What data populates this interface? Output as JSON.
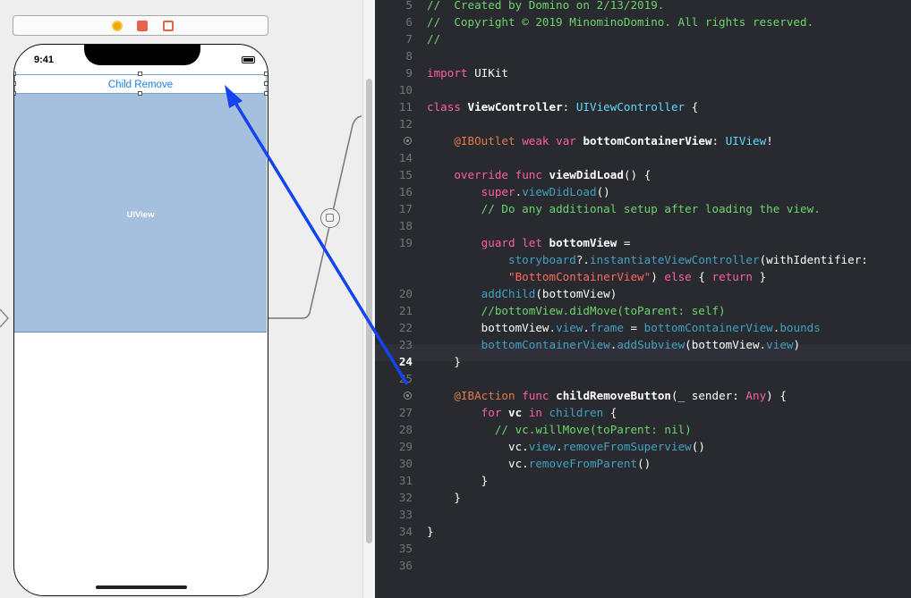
{
  "storyboard": {
    "scene_dock": {
      "icons": [
        "view-controller-icon",
        "first-responder-icon",
        "exit-icon"
      ]
    },
    "phone": {
      "status_time": "9:41",
      "button_title": "Child Remove",
      "view_label": "UIView"
    }
  },
  "code": {
    "lines": [
      {
        "n": "5",
        "tokens": [
          [
            "cm",
            "//  Created by Domino on 2/13/2019."
          ]
        ]
      },
      {
        "n": "6",
        "tokens": [
          [
            "cm",
            "//  Copyright © 2019 MinominoDomino. All rights reserved."
          ]
        ]
      },
      {
        "n": "7",
        "tokens": [
          [
            "cm",
            "//"
          ]
        ]
      },
      {
        "n": "8",
        "tokens": []
      },
      {
        "n": "9",
        "tokens": [
          [
            "kw",
            "import"
          ],
          [
            "pl",
            " UIKit"
          ]
        ]
      },
      {
        "n": "10",
        "tokens": []
      },
      {
        "n": "11",
        "tokens": [
          [
            "kw",
            "class"
          ],
          [
            "pl bold",
            " ViewController"
          ],
          [
            "pl",
            ": "
          ],
          [
            "ty",
            "UIViewController"
          ],
          [
            "pl",
            " {"
          ]
        ]
      },
      {
        "n": "12",
        "tokens": []
      },
      {
        "n": "",
        "outlet": true,
        "tokens": [
          [
            "pl",
            "    "
          ],
          [
            "at",
            "@IBOutlet"
          ],
          [
            "pl",
            " "
          ],
          [
            "kw",
            "weak"
          ],
          [
            "pl",
            " "
          ],
          [
            "kw",
            "var"
          ],
          [
            "pl bold",
            " bottomContainerView"
          ],
          [
            "pl",
            ": "
          ],
          [
            "ty",
            "UIView"
          ],
          [
            "pl",
            "!"
          ]
        ]
      },
      {
        "n": "14",
        "tokens": []
      },
      {
        "n": "15",
        "tokens": [
          [
            "pl",
            "    "
          ],
          [
            "kw",
            "override"
          ],
          [
            "pl",
            " "
          ],
          [
            "kw",
            "func"
          ],
          [
            "pl bold",
            " viewDidLoad"
          ],
          [
            "pl",
            "() {"
          ]
        ]
      },
      {
        "n": "16",
        "tokens": [
          [
            "pl",
            "        "
          ],
          [
            "kw",
            "super"
          ],
          [
            "pl",
            "."
          ],
          [
            "fn",
            "viewDidLoad"
          ],
          [
            "pl",
            "()"
          ]
        ]
      },
      {
        "n": "17",
        "tokens": [
          [
            "pl",
            "        "
          ],
          [
            "cm",
            "// Do any additional setup after loading the view."
          ]
        ]
      },
      {
        "n": "18",
        "tokens": []
      },
      {
        "n": "19",
        "tokens": [
          [
            "pl",
            "        "
          ],
          [
            "kw",
            "guard"
          ],
          [
            "pl",
            " "
          ],
          [
            "kw",
            "let"
          ],
          [
            "pl bold",
            " bottomView"
          ],
          [
            "pl",
            " ="
          ]
        ]
      },
      {
        "n": "",
        "tokens": [
          [
            "pl",
            "            "
          ],
          [
            "fn",
            "storyboard"
          ],
          [
            "pl",
            "?."
          ],
          [
            "fn",
            "instantiateViewController"
          ],
          [
            "pl",
            "(withIdentifier:"
          ]
        ]
      },
      {
        "n": "",
        "tokens": [
          [
            "pl",
            "            "
          ],
          [
            "str",
            "\"BottomContainerView\""
          ],
          [
            "pl",
            ") "
          ],
          [
            "kw",
            "else"
          ],
          [
            "pl",
            " { "
          ],
          [
            "kw",
            "return"
          ],
          [
            "pl",
            " }"
          ]
        ]
      },
      {
        "n": "20",
        "tokens": [
          [
            "pl",
            "        "
          ],
          [
            "fn",
            "addChild"
          ],
          [
            "pl",
            "(bottomView)"
          ]
        ]
      },
      {
        "n": "21",
        "tokens": [
          [
            "pl",
            "        "
          ],
          [
            "cm",
            "//bottomView.didMove(toParent: self)"
          ]
        ]
      },
      {
        "n": "22",
        "tokens": [
          [
            "pl",
            "        bottomView."
          ],
          [
            "fn",
            "view"
          ],
          [
            "pl",
            "."
          ],
          [
            "fn",
            "frame"
          ],
          [
            "pl",
            " = "
          ],
          [
            "fn",
            "bottomContainerView"
          ],
          [
            "pl",
            "."
          ],
          [
            "fn",
            "bounds"
          ]
        ]
      },
      {
        "n": "23",
        "tokens": [
          [
            "pl",
            "        "
          ],
          [
            "fn",
            "bottomContainerView"
          ],
          [
            "pl",
            "."
          ],
          [
            "fn",
            "addSubview"
          ],
          [
            "pl",
            "(bottomView."
          ],
          [
            "fn",
            "view"
          ],
          [
            "pl",
            ")"
          ]
        ]
      },
      {
        "n": "24",
        "current": true,
        "tokens": [
          [
            "pl",
            "    }"
          ]
        ]
      },
      {
        "n": "25",
        "tokens": []
      },
      {
        "n": "",
        "outlet": true,
        "tokens": [
          [
            "pl",
            "    "
          ],
          [
            "at",
            "@IBAction"
          ],
          [
            "pl",
            " "
          ],
          [
            "kw",
            "func"
          ],
          [
            "pl bold",
            " childRemoveButton"
          ],
          [
            "pl",
            "(_ sender: "
          ],
          [
            "kw",
            "Any"
          ],
          [
            "pl",
            ") {"
          ]
        ]
      },
      {
        "n": "27",
        "tokens": [
          [
            "pl",
            "        "
          ],
          [
            "kw",
            "for"
          ],
          [
            "pl bold",
            " vc"
          ],
          [
            "pl",
            " "
          ],
          [
            "kw",
            "in"
          ],
          [
            "pl",
            " "
          ],
          [
            "fn",
            "children"
          ],
          [
            "pl",
            " {"
          ]
        ]
      },
      {
        "n": "28",
        "tokens": [
          [
            "pl",
            "          "
          ],
          [
            "cm",
            "// vc.willMove(toParent: nil)"
          ]
        ]
      },
      {
        "n": "29",
        "tokens": [
          [
            "pl",
            "            vc."
          ],
          [
            "fn",
            "view"
          ],
          [
            "pl",
            "."
          ],
          [
            "fn",
            "removeFromSuperview"
          ],
          [
            "pl",
            "()"
          ]
        ]
      },
      {
        "n": "30",
        "tokens": [
          [
            "pl",
            "            vc."
          ],
          [
            "fn",
            "removeFromParent"
          ],
          [
            "pl",
            "()"
          ]
        ]
      },
      {
        "n": "31",
        "tokens": [
          [
            "pl",
            "        }"
          ]
        ]
      },
      {
        "n": "32",
        "tokens": [
          [
            "pl",
            "    }"
          ]
        ]
      },
      {
        "n": "33",
        "tokens": []
      },
      {
        "n": "34",
        "tokens": [
          [
            "pl",
            "}"
          ]
        ]
      },
      {
        "n": "35",
        "tokens": []
      },
      {
        "n": "36",
        "tokens": []
      }
    ]
  },
  "colors": {
    "editor_background": "#292a30",
    "keyword": "#fc5fa3",
    "comment": "#6bd56a",
    "type": "#5dd8ff",
    "function": "#41a1c0",
    "string": "#fc6a5d",
    "button_tint": "#1c7ee6",
    "connection_arrow": "#1443f0"
  }
}
